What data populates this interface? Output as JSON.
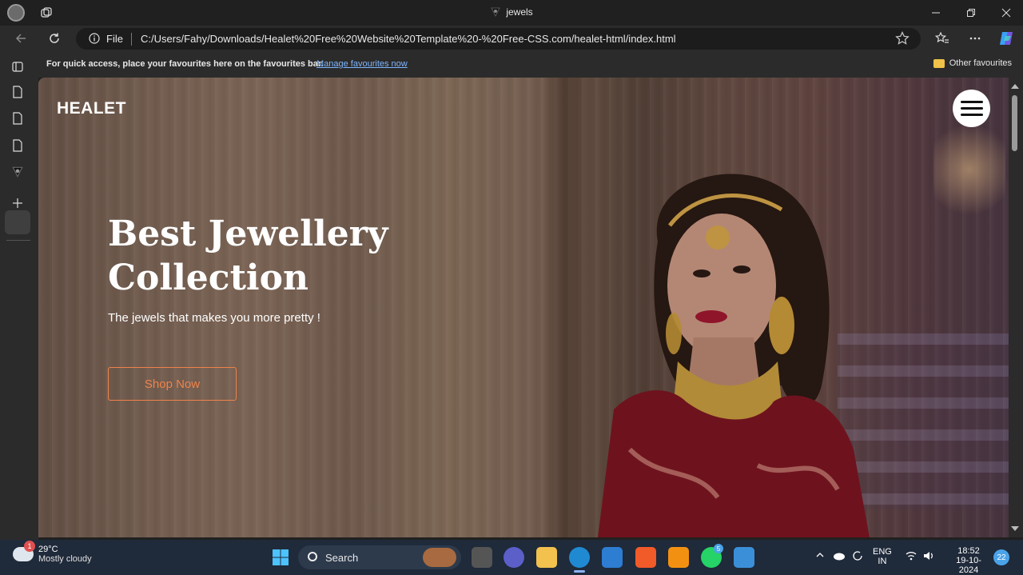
{
  "browser": {
    "tab_title": "jewels",
    "address": {
      "protocol_label": "File",
      "url": "C:/Users/Fahy/Downloads/Healet%20Free%20Website%20Template%20-%20Free-CSS.com/healet-html/index.html"
    },
    "favorites_bar": {
      "message": "For quick access, place your favourites here on the favourites bar.",
      "manage_link": "Manage favourites now",
      "other_label": "Other favourites"
    }
  },
  "site": {
    "brand": "HEALET",
    "hero_title_line1": "Best Jewellery",
    "hero_title_line2": "Collection",
    "hero_subtitle": "The jewels that makes you more pretty !",
    "cta_label": "Shop Now",
    "accent_color": "#f0824a"
  },
  "taskbar": {
    "weather_temp": "29°C",
    "weather_desc": "Mostly cloudy",
    "weather_badge": "1",
    "search_label": "Search",
    "whatsapp_badge": "5",
    "language_line1": "ENG",
    "language_line2": "IN",
    "time": "18:52",
    "date": "19-10-2024",
    "notification_count": "22"
  }
}
